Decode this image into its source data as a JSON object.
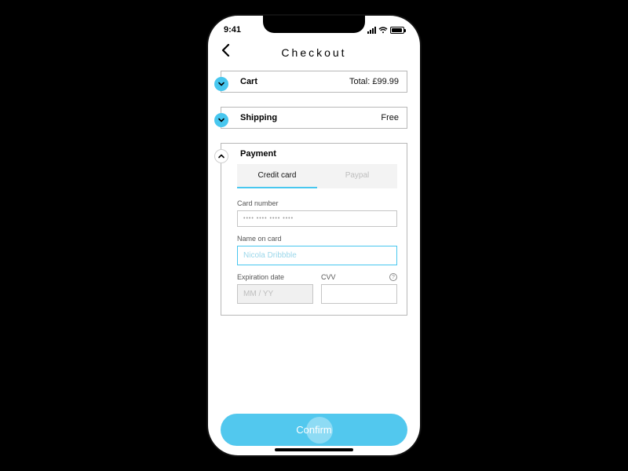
{
  "status": {
    "time": "9:41"
  },
  "header": {
    "title": "Checkout"
  },
  "sections": {
    "cart": {
      "label": "Cart",
      "value": "Total: £99.99"
    },
    "shipping": {
      "label": "Shipping",
      "value": "Free"
    },
    "payment": {
      "label": "Payment"
    }
  },
  "tabs": {
    "credit": "Credit card",
    "paypal": "Paypal"
  },
  "fields": {
    "card_number_label": "Card number",
    "card_number_mask": "•••• •••• •••• ••••",
    "name_label": "Name on card",
    "name_value": "Nicola Dribbble",
    "exp_label": "Expiration date",
    "exp_placeholder": "MM / YY",
    "cvv_label": "CVV"
  },
  "cta": {
    "confirm": "Confirm"
  }
}
